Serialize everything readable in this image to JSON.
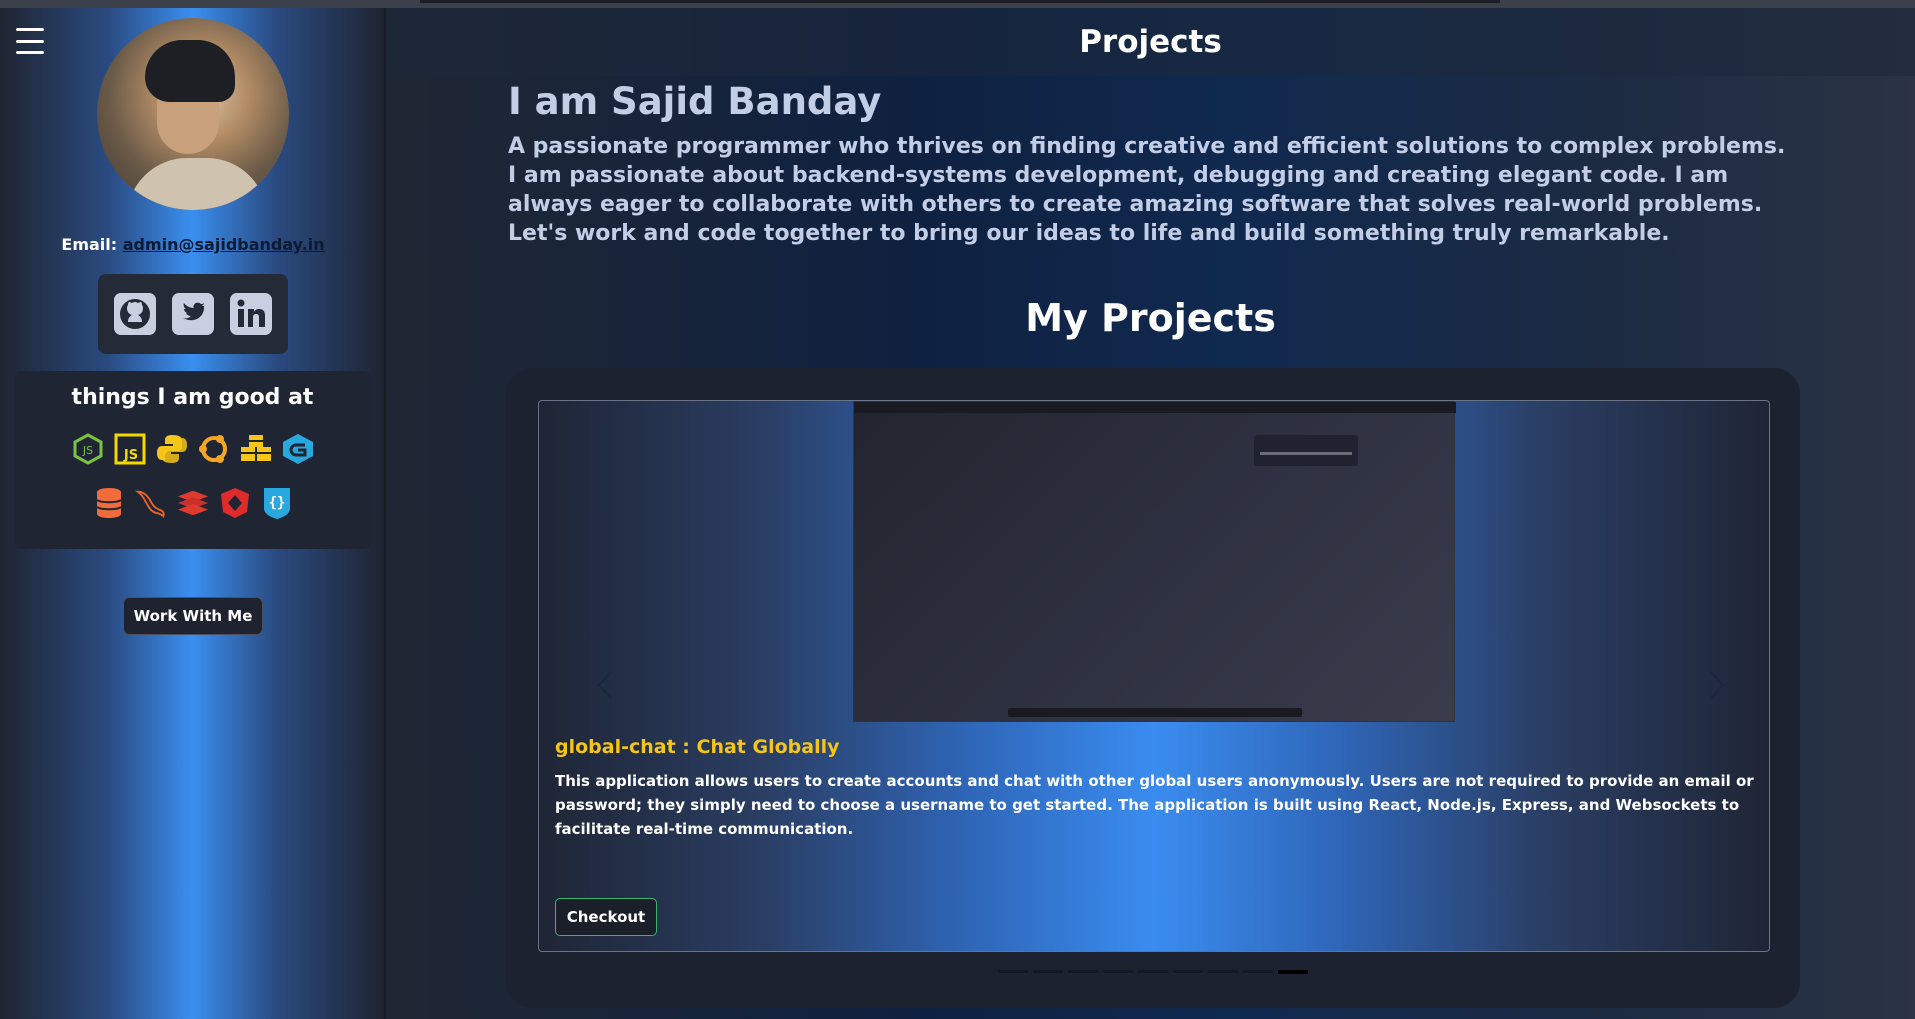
{
  "sidebar": {
    "menu_icon": "hamburger-icon",
    "email_label": "Email:",
    "email_value": "admin@sajidbanday.in",
    "socials": [
      {
        "name": "github-icon"
      },
      {
        "name": "twitter-icon"
      },
      {
        "name": "linkedin-icon"
      }
    ],
    "skills_title": "things I am good at",
    "skills_row1": [
      "nodejs-icon",
      "javascript-icon",
      "python-icon",
      "ubuntu-icon",
      "packages-icon",
      "go-icon"
    ],
    "skills_row2": [
      "database-icon",
      "mysql-icon",
      "redis-icon",
      "nestjs-icon",
      "json-icon"
    ],
    "work_button": "Work With Me"
  },
  "header": {
    "title": "Projects"
  },
  "intro": {
    "title": "I am Sajid Banday",
    "text": "A passionate programmer who thrives on finding creative and efficient solutions to complex problems. I am passionate about backend-systems development, debugging and creating elegant code. I am always eager to collaborate with others to create amazing software that solves real-world problems. Let's work and code together to bring our ideas to life and build something truly remarkable."
  },
  "projects": {
    "title": "My Projects",
    "current": {
      "title": "global-chat : Chat Globally",
      "description": "This application allows users to create accounts and chat with other global users anonymously. Users are not required to provide an email or password; they simply need to choose a username to get started. The application is built using React, Node.js, Express, and Websockets to facilitate real-time communication.",
      "button": "Checkout"
    },
    "slide_count": 9,
    "active_slide": 9
  },
  "colors": {
    "accent_yellow": "#f5c518",
    "checkout_border": "#3cb371",
    "sidebar_blue": "#3a8ff0"
  }
}
